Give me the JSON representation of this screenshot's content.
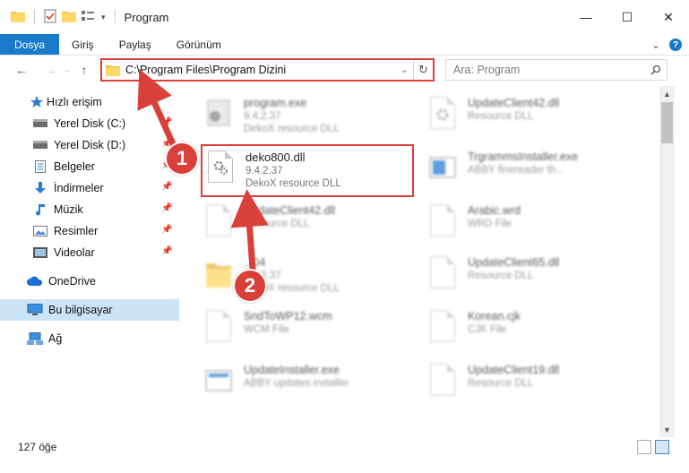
{
  "window": {
    "title": "Program",
    "minimize_glyph": "—",
    "maximize_glyph": "☐",
    "close_glyph": "✕"
  },
  "ribbon": {
    "tabs": [
      "Dosya",
      "Giriş",
      "Paylaş",
      "Görünüm"
    ],
    "expand_glyph": "⌄",
    "help_glyph": "?"
  },
  "nav": {
    "back_glyph": "←",
    "forward_glyph": "→",
    "recent_glyph": "⌄",
    "up_glyph": "↑",
    "address": "C:\\Program Files\\Program Dizini",
    "address_drop_glyph": "⌄",
    "refresh_glyph": "↻",
    "search_placeholder": "Ara: Program",
    "search_glyph": "⚲"
  },
  "sidebar": {
    "items": [
      {
        "label": "Hızlı erişim",
        "icon": "star-icon"
      },
      {
        "label": "Yerel Disk (C:)",
        "icon": "drive-icon"
      },
      {
        "label": "Yerel Disk (D:)",
        "icon": "drive-icon"
      },
      {
        "label": "Belgeler",
        "icon": "documents-icon"
      },
      {
        "label": "İndirmeler",
        "icon": "downloads-icon"
      },
      {
        "label": "Müzik",
        "icon": "music-icon"
      },
      {
        "label": "Resimler",
        "icon": "pictures-icon"
      },
      {
        "label": "Videolar",
        "icon": "videos-icon"
      },
      {
        "label": "OneDrive",
        "icon": "cloud-icon"
      },
      {
        "label": "Bu bilgisayar",
        "icon": "computer-icon"
      },
      {
        "label": "Ağ",
        "icon": "network-icon"
      }
    ]
  },
  "files": [
    {
      "name": "program.exe",
      "sub": "9.4.2.37",
      "sub2": "DekoX resource DLL"
    },
    {
      "name": "UpdateClient42.dll",
      "sub": "Resource DLL",
      "sub2": ""
    },
    {
      "name": "deko800.dll",
      "sub": "9.4.2.37",
      "sub2": "DekoX resource DLL"
    },
    {
      "name": "TrgrammsInstaller.exe",
      "sub": "ABBY finereader th...",
      "sub2": ""
    },
    {
      "name": "UpdateClient42.dll",
      "sub": "Resource DLL",
      "sub2": ""
    },
    {
      "name": "Arabic.wrd",
      "sub": "WRD File",
      "sub2": ""
    },
    {
      "name": "...04",
      "sub": "9.4.2.37",
      "sub2": "DekoX resource DLL"
    },
    {
      "name": "UpdateClient65.dll",
      "sub": "Resource DLL",
      "sub2": ""
    },
    {
      "name": "SndToWP12.wcm",
      "sub": "WCM File",
      "sub2": ""
    },
    {
      "name": "Korean.cjk",
      "sub": "CJK File",
      "sub2": ""
    },
    {
      "name": "UpdateInstaller.exe",
      "sub": "ABBY updates installer",
      "sub2": ""
    },
    {
      "name": "UpdateClient19.dll",
      "sub": "Resource DLL",
      "sub2": ""
    }
  ],
  "status": {
    "count": "127 öğe"
  },
  "scroll": {
    "up_glyph": "▲",
    "down_glyph": "▼"
  },
  "annotations": {
    "step1": "1",
    "step2": "2"
  },
  "colors": {
    "accent": "#1979ca",
    "highlight_red": "#d9403a",
    "selected_bg": "#cce4f7"
  }
}
